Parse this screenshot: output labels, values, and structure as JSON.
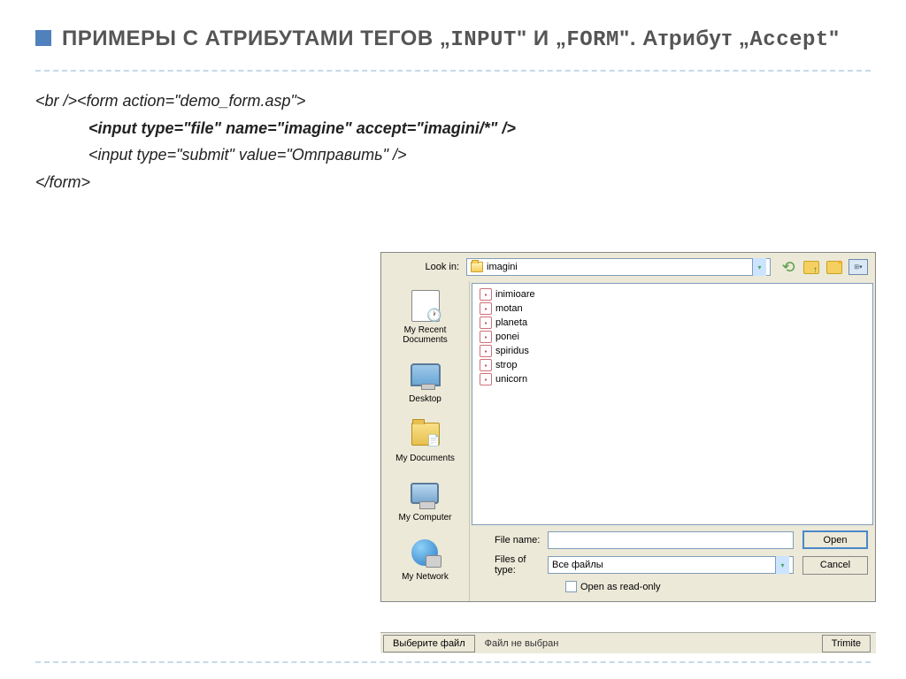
{
  "title_part1": "ПРИМЕРЫ С АТРИБУТАМИ ТЕГОВ „",
  "title_code1": "INPUT",
  "title_part2": "\"  И „",
  "title_code2": "FORM",
  "title_part3": "\". Атрибут „",
  "title_code3": "Accept",
  "title_part4": "\"",
  "code": {
    "line1": "<br /><form action=\"demo_form.asp\">",
    "line2": "<input type=\"file\" name=\"imagine\" accept=\"imagini/*\" />",
    "line3": "<input type=\"submit\" value=\"Отправить\" />",
    "line4": "</form>"
  },
  "dialog": {
    "lookin_label": "Look in:",
    "lookin_value": "imagini",
    "sidebar": [
      "My Recent Documents",
      "Desktop",
      "My Documents",
      "My Computer",
      "My Network"
    ],
    "files": [
      "inimioare",
      "motan",
      "planeta",
      "ponei",
      "spiridus",
      "strop",
      "unicorn"
    ],
    "filename_label": "File name:",
    "filename_value": "",
    "filetype_label": "Files of type:",
    "filetype_value": "Все файлы",
    "readonly_label": "Open as read-only",
    "open_btn": "Open",
    "cancel_btn": "Cancel"
  },
  "statusbar": {
    "choose": "Выберите файл",
    "nofile": "Файл не выбран",
    "submit": "Trimite"
  }
}
